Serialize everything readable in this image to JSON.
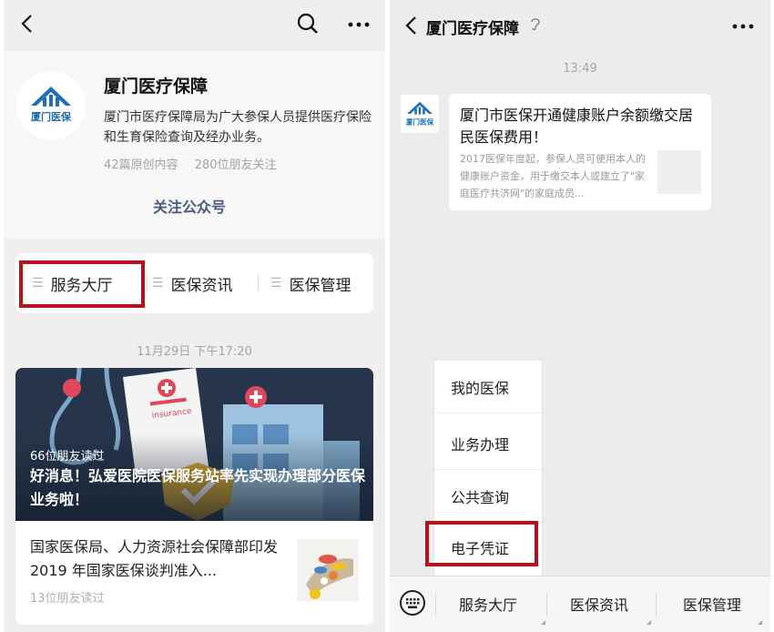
{
  "left_panel": {
    "account": {
      "name": "厦门医疗保障",
      "description": "厦门市医疗保障局为广大参保人员提供医疗保险和生育保险查询及经办业务。",
      "original_count": "42篇原创内容",
      "friends_following": "280位朋友关注",
      "follow_label": "关注公众号",
      "logo_text": "厦门医保"
    },
    "menu": [
      {
        "label": "服务大厅"
      },
      {
        "label": "医保资讯"
      },
      {
        "label": "医保管理"
      }
    ],
    "message_time": "11月29日 下午17:20",
    "article": {
      "read_count": "66位朋友读过",
      "title": "好消息！弘爱医院医保服务站率先实现办理部分医保业务啦！",
      "cover_label": "insurance",
      "sub_title": "国家医保局、人力资源社会保障部印发 2019 年国家医保谈判准入...",
      "sub_read_count": "13位朋友读过"
    }
  },
  "right_panel": {
    "title": "厦门医疗保障",
    "time": "13:49",
    "card": {
      "title": "厦门市医保开通健康账户余额缴交居民医保费用！",
      "desc": "2017医保年度起，参保人员可使用本人的健康账户资金，用于缴交本人或建立了\"家庭医疗共济网\"的家庭成员..."
    },
    "popup": [
      {
        "label": "我的医保"
      },
      {
        "label": "业务办理"
      },
      {
        "label": "公共查询"
      },
      {
        "label": "电子凭证"
      }
    ],
    "bottom_menu": [
      {
        "label": "服务大厅"
      },
      {
        "label": "医保资讯"
      },
      {
        "label": "医保管理"
      }
    ]
  },
  "colors": {
    "highlight": "#b5121b",
    "logo_blue": "#1f6fb2",
    "follow_link": "#485a7e"
  },
  "icons": [
    "back-icon",
    "search-icon",
    "more-icon",
    "menu-lines-icon",
    "keyboard-icon",
    "ear-icon"
  ]
}
